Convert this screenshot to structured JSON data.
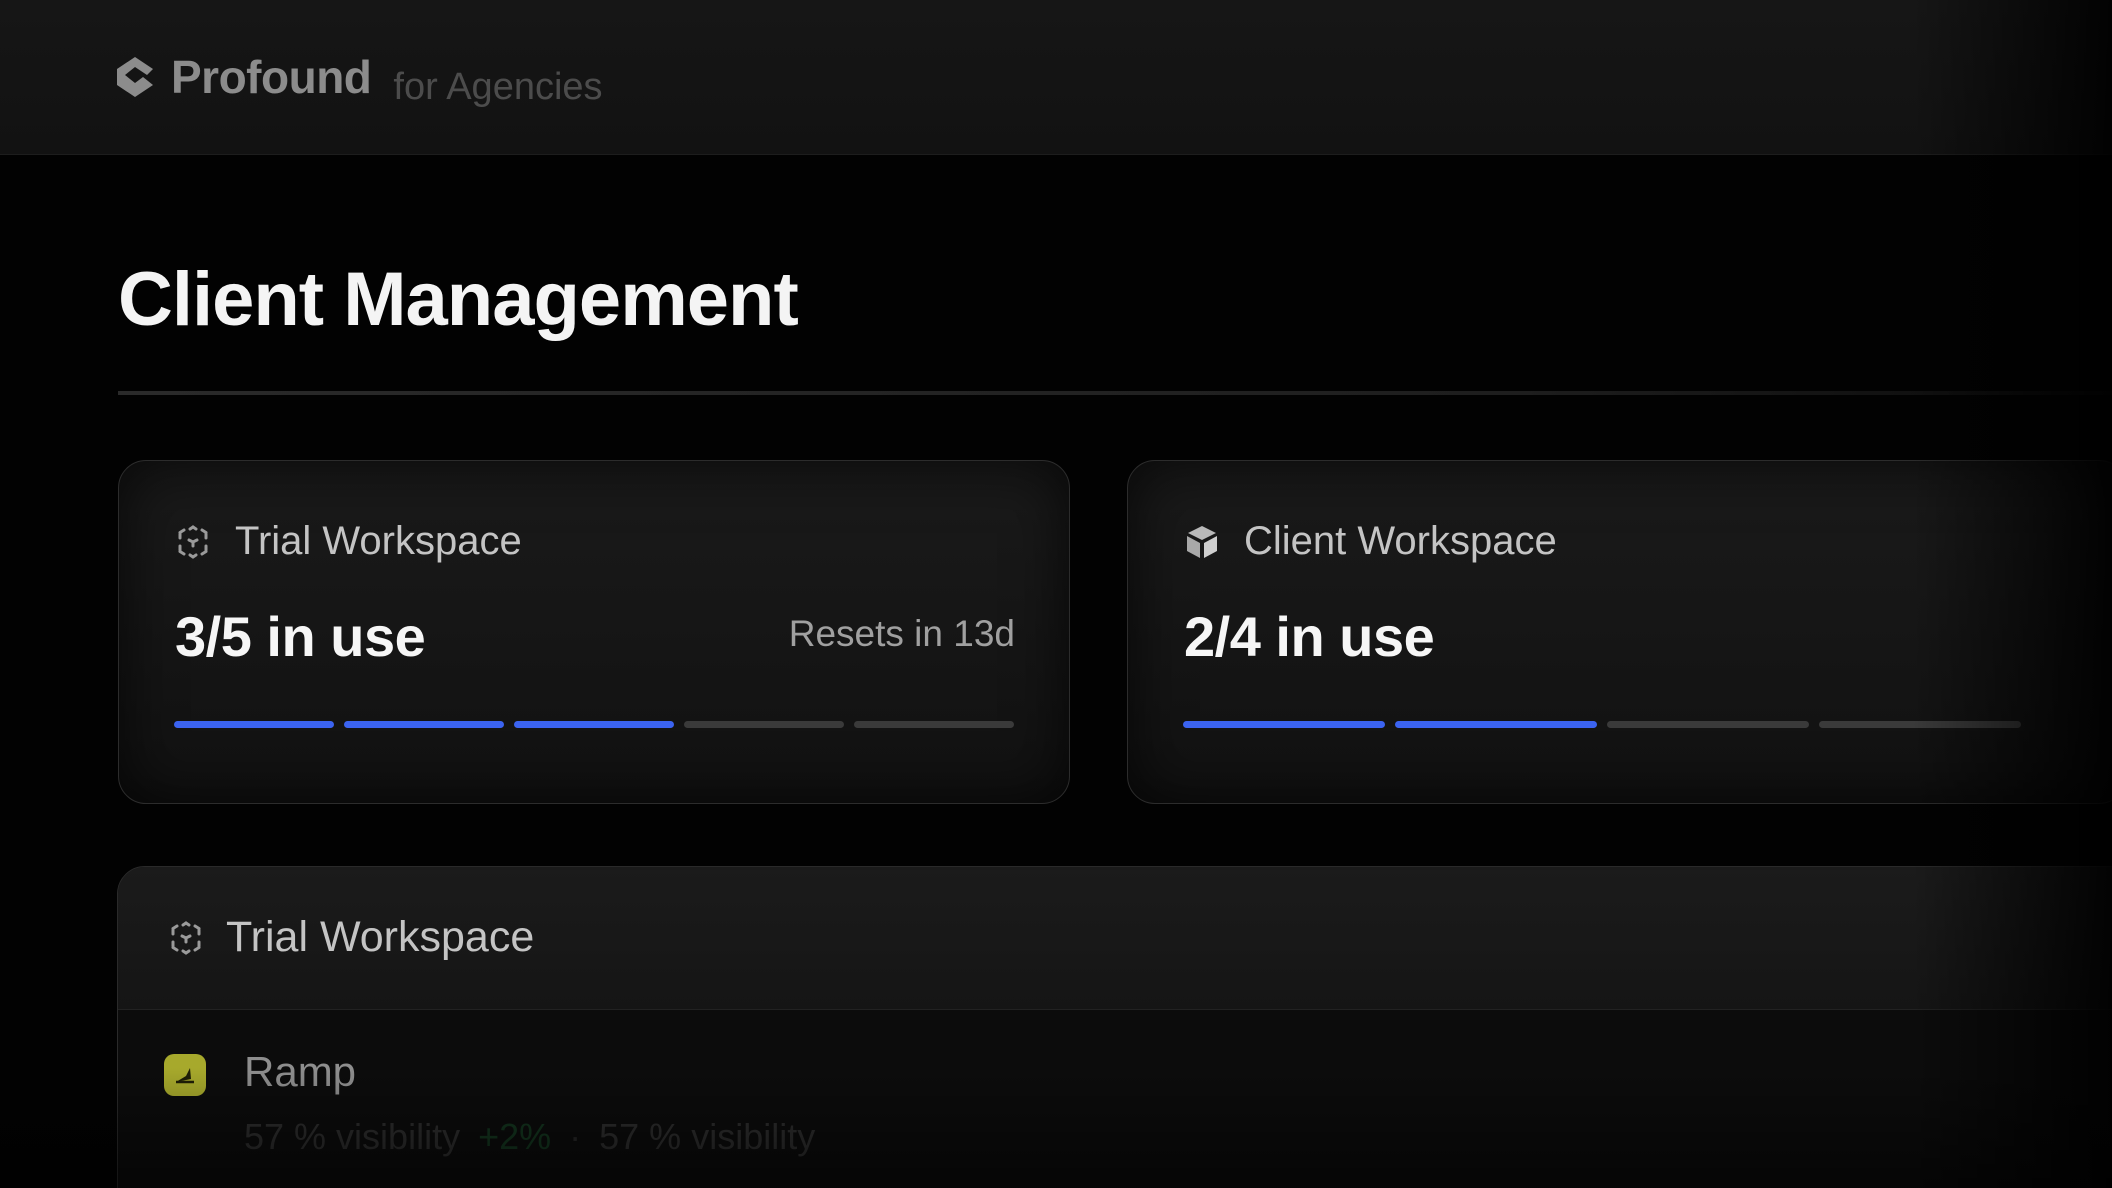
{
  "header": {
    "brand_name": "Profound",
    "brand_sub": "for Agencies",
    "logo_icon": "profound-logo-icon"
  },
  "page": {
    "title": "Client Management"
  },
  "cards": {
    "trial": {
      "icon": "dashed-cube-icon",
      "label": "Trial Workspace",
      "usage": "3/5 in use",
      "used": 3,
      "total": 5,
      "resets": "Resets in 13d"
    },
    "client": {
      "icon": "cube-icon",
      "label": "Client Workspace",
      "usage": "2/4 in use",
      "used": 2,
      "total": 4
    }
  },
  "workspace_panel": {
    "icon": "dashed-cube-icon",
    "title": "Trial Workspace",
    "rows": [
      {
        "name": "Ramp",
        "logo_icon": "ramp-logo-icon",
        "visibility": "57 % visibility",
        "delta": "+2%",
        "separator": "·",
        "visibility_2": "57 % visibility"
      }
    ]
  },
  "colors": {
    "accent": "#3b63f0",
    "segment_off": "#3a3a3a",
    "ramp_brand": "#a7a92c"
  }
}
